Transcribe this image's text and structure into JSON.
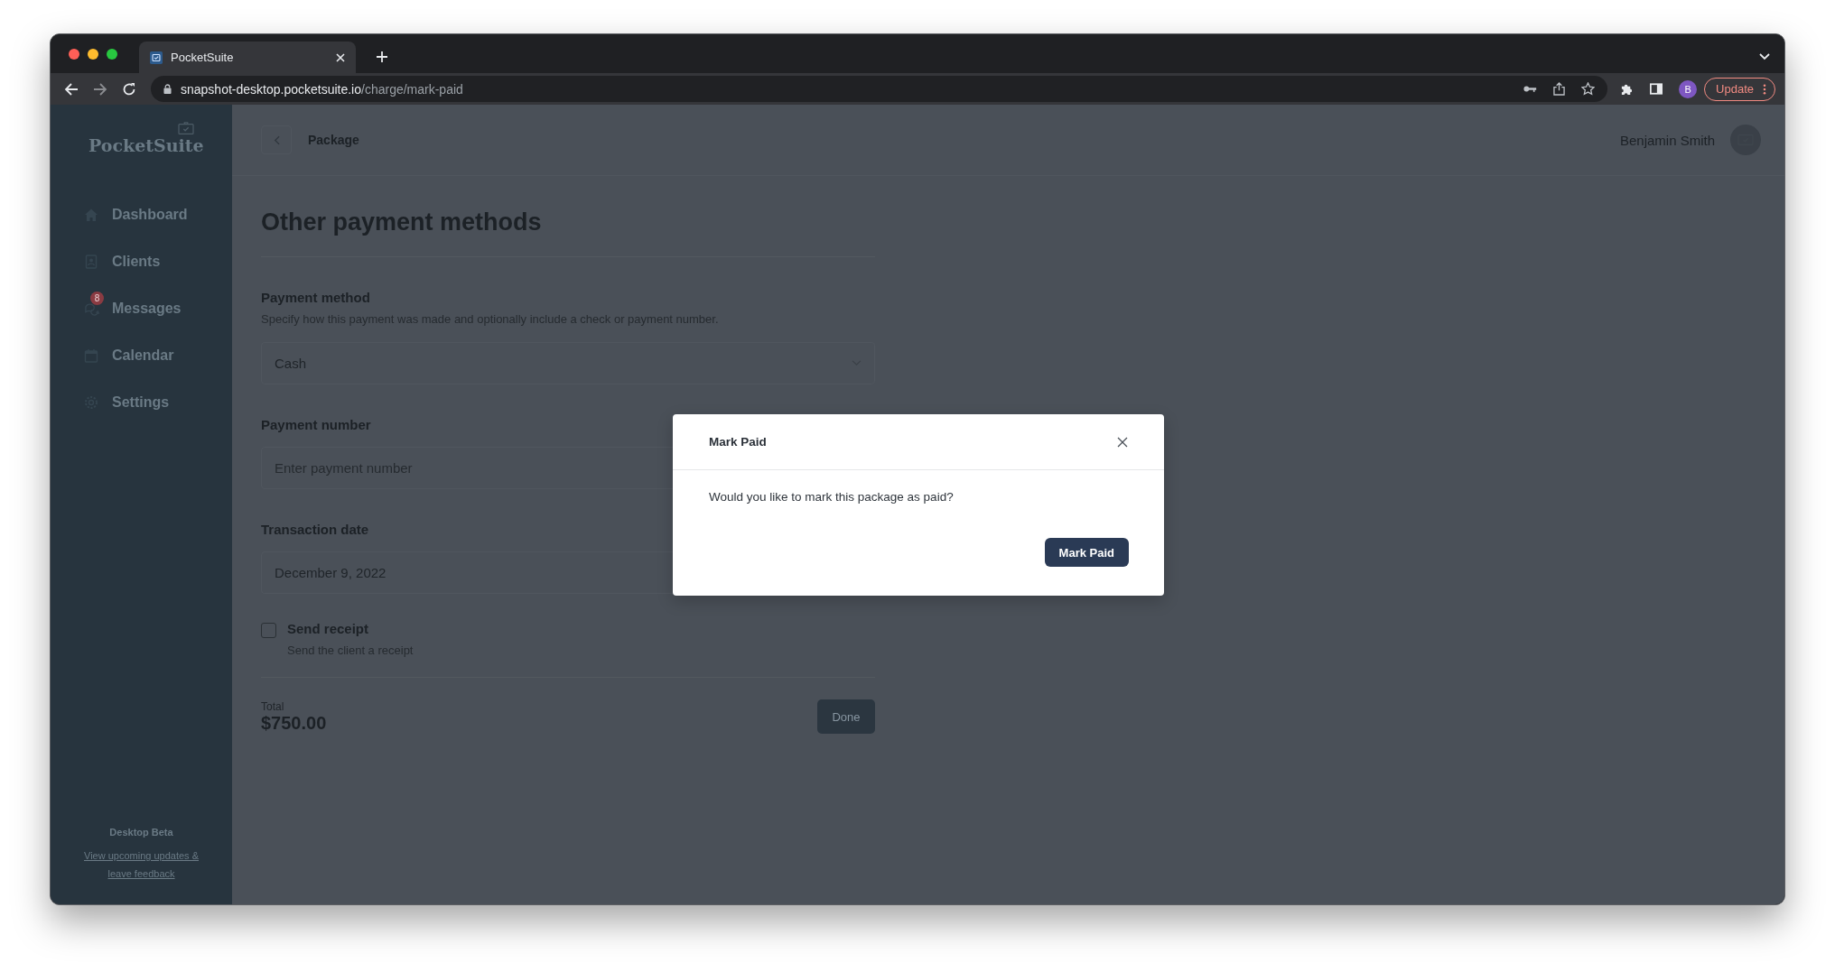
{
  "browser": {
    "tab_title": "PocketSuite",
    "url_host": "snapshot-desktop.pocketsuite.io",
    "url_path": "/charge/mark-paid",
    "profile_initial": "B",
    "update_button": "Update"
  },
  "sidebar": {
    "logo": "PocketSuite",
    "items": [
      {
        "label": "Dashboard"
      },
      {
        "label": "Clients"
      },
      {
        "label": "Messages",
        "badge": "8"
      },
      {
        "label": "Calendar"
      },
      {
        "label": "Settings"
      }
    ],
    "footer_title": "Desktop Beta",
    "footer_link": "View upcoming updates & leave feedback"
  },
  "header": {
    "title": "Package",
    "user_name": "Benjamin Smith"
  },
  "form": {
    "heading": "Other payment methods",
    "payment_method": {
      "label": "Payment method",
      "description": "Specify how this payment was made and optionally include a check or payment number.",
      "value": "Cash"
    },
    "payment_number": {
      "label": "Payment number",
      "placeholder": "Enter payment number"
    },
    "transaction_date": {
      "label": "Transaction date",
      "value": "December 9, 2022"
    },
    "send_receipt": {
      "label": "Send receipt",
      "description": "Send the client a receipt",
      "checked": false
    },
    "total": {
      "label": "Total",
      "value": "$750.00"
    },
    "done_button": "Done"
  },
  "modal": {
    "title": "Mark Paid",
    "message": "Would you like to mark this package as paid?",
    "confirm_button": "Mark Paid"
  }
}
